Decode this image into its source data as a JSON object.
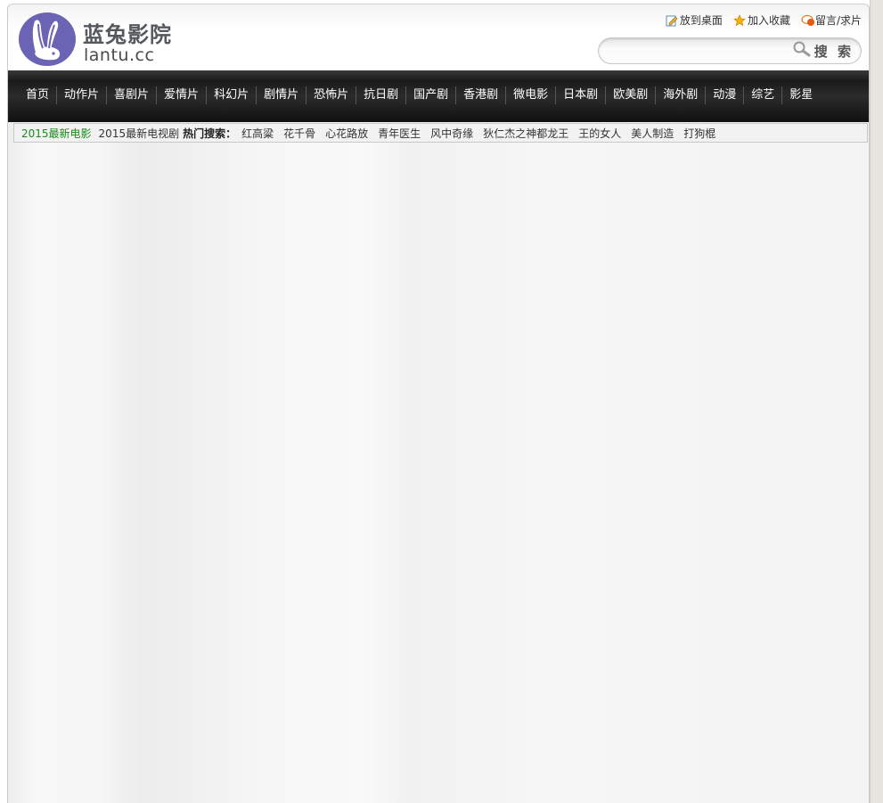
{
  "header": {
    "logo_cn": "蓝兔影院",
    "logo_en": "lantu.cc",
    "links": [
      {
        "label": "放到桌面",
        "icon": "desktop-edit-icon"
      },
      {
        "label": "加入收藏",
        "icon": "star-icon"
      },
      {
        "label": "留言/求片",
        "icon": "comment-icon"
      }
    ],
    "search": {
      "placeholder": "",
      "button_label": "搜 索"
    }
  },
  "nav": {
    "items": [
      "首页",
      "动作片",
      "喜剧片",
      "爱情片",
      "科幻片",
      "剧情片",
      "恐怖片",
      "抗日剧",
      "国产剧",
      "香港剧",
      "微电影",
      "日本剧",
      "欧美剧",
      "海外剧",
      "动漫",
      "综艺",
      "影星"
    ]
  },
  "hotbar": {
    "link_new_movies": "2015最新电影",
    "link_new_tv": "2015最新电视剧",
    "hot_label": "热门搜索：",
    "hot_items": [
      "红高粱",
      "花千骨",
      "心花路放",
      "青年医生",
      "风中奇缘",
      "狄仁杰之神都龙王",
      "王的女人",
      "美人制造",
      "打狗棍"
    ]
  },
  "colors": {
    "logo_purple": "#6b63b3",
    "nav_bg": "#1b1b1b",
    "hot_green": "#1a8a1a"
  }
}
